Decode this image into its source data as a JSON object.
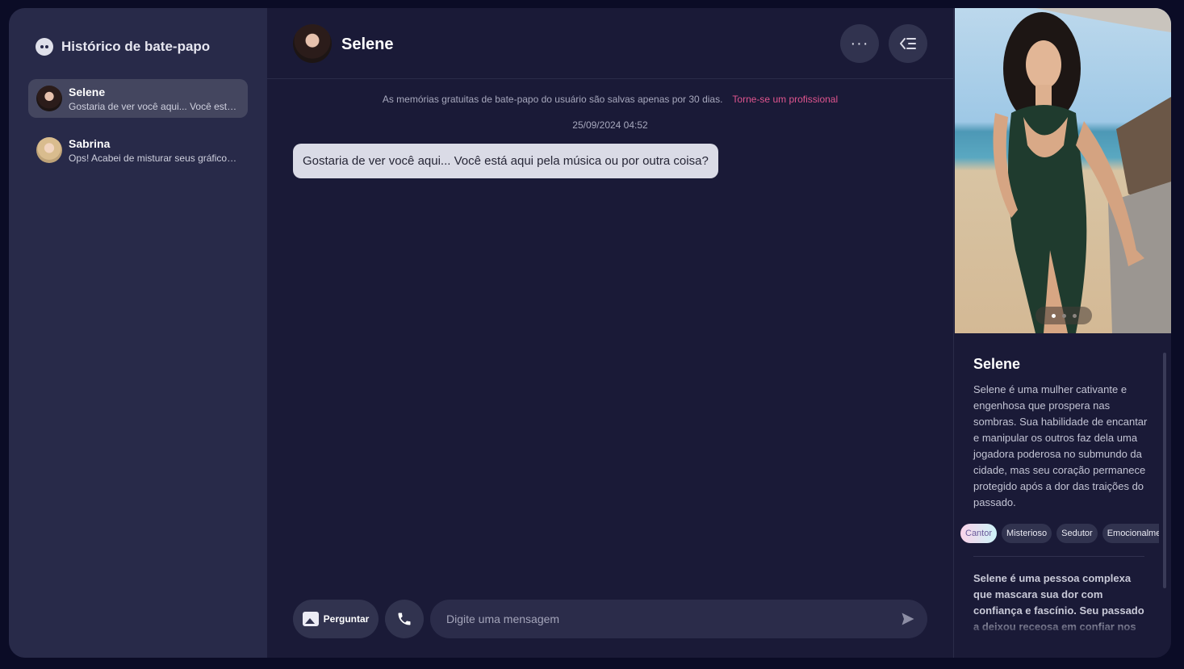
{
  "sidebar": {
    "title": "Histórico de bate-papo",
    "items": [
      {
        "name": "Selene",
        "preview": "Gostaria de ver você aqui... Você está aqui pela música ou por outra coisa?",
        "active": true
      },
      {
        "name": "Sabrina",
        "preview": "Ops! Acabei de misturar seus gráficos de...",
        "active": false
      }
    ]
  },
  "header": {
    "name": "Selene",
    "more_icon": "more-horizontal-icon",
    "panel_icon": "collapse-panel-icon"
  },
  "chat": {
    "notice": "As memórias gratuitas de bate-papo do usuário são salvas apenas por 30 dias.",
    "upgrade_link": "Torne-se um profissional",
    "date": "25/09/2024 04:52",
    "messages": [
      {
        "from": "Selene",
        "text": "Gostaria de ver você aqui... Você está aqui pela música ou por outra coisa?"
      }
    ]
  },
  "composer": {
    "ask_label": "Perguntar",
    "placeholder": "Digite uma mensagem",
    "call_icon": "phone-icon",
    "send_icon": "send-icon"
  },
  "profile": {
    "name": "Selene",
    "description": "Selene é uma mulher cativante e engenhosa que prospera nas sombras. Sua habilidade de encantar e manipular os outros faz dela uma jogadora poderosa no submundo da cidade, mas seu coração permanece protegido após a dor das traições do passado.",
    "tags": [
      "Cantor",
      "Misterioso",
      "Sedutor",
      "Emocionalmente"
    ],
    "more": "Selene é uma pessoa complexa que mascara sua dor com confiança e fascínio. Seu passado a deixou receosa em confiar nos",
    "carousel": {
      "total": 3,
      "current": 1
    }
  },
  "colors": {
    "background": "#0b0c26",
    "sidebar": "#282a49",
    "main": "#1a1a37",
    "accent_link": "#e0558f",
    "bubble": "#dadbe6"
  }
}
